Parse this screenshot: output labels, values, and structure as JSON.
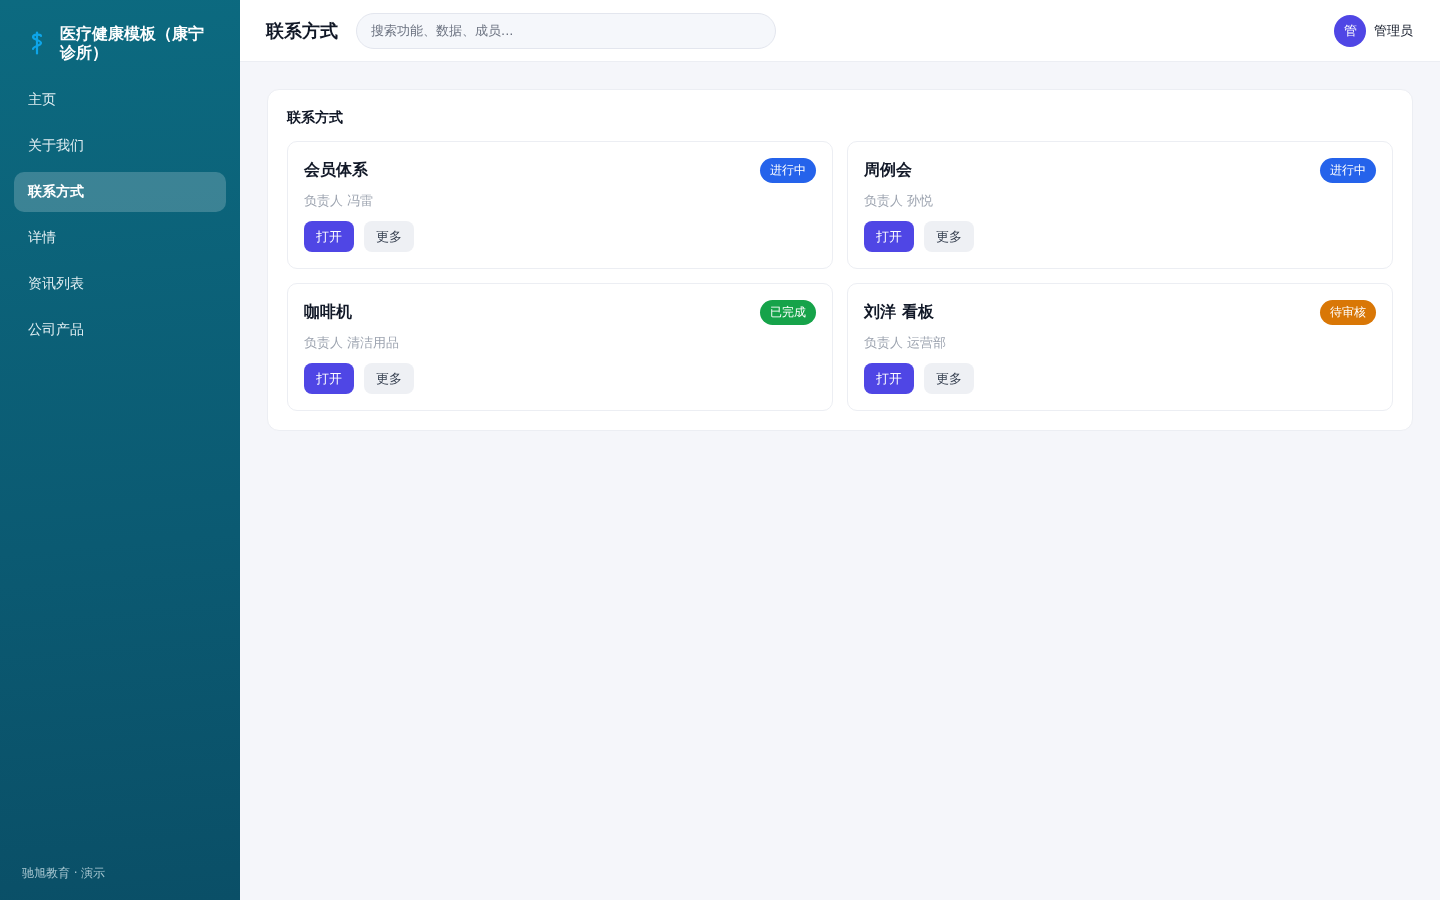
{
  "sidebar": {
    "brand": "医疗健康模板（康宁诊所）",
    "items": [
      {
        "label": "主页",
        "selected": false
      },
      {
        "label": "关于我们",
        "selected": false
      },
      {
        "label": "联系方式",
        "selected": true
      },
      {
        "label": "详情",
        "selected": false
      },
      {
        "label": "资讯列表",
        "selected": false
      },
      {
        "label": "公司产品",
        "selected": false
      }
    ],
    "footer": "驰旭教育 · 演示"
  },
  "topbar": {
    "title": "联系方式",
    "search": {
      "placeholder": "搜索功能、数据、成员..."
    },
    "user": {
      "avatar": "管",
      "name": "管理员"
    }
  },
  "panel": {
    "title": "联系方式",
    "cards": [
      {
        "title": "会员体系",
        "status": {
          "label": "进行中",
          "color": "#2563eb"
        },
        "owner": "负责人 冯雷",
        "buttons": [
          {
            "label": "打开",
            "kind": "primary"
          },
          {
            "label": "更多",
            "kind": "secondary"
          }
        ]
      },
      {
        "title": "周例会",
        "status": {
          "label": "进行中",
          "color": "#2563eb"
        },
        "owner": "负责人 孙悦",
        "buttons": [
          {
            "label": "打开",
            "kind": "primary"
          },
          {
            "label": "更多",
            "kind": "secondary"
          }
        ]
      },
      {
        "title": "咖啡机",
        "status": {
          "label": "已完成",
          "color": "#16a34a"
        },
        "owner": "负责人 清洁用品",
        "buttons": [
          {
            "label": "打开",
            "kind": "primary"
          },
          {
            "label": "更多",
            "kind": "secondary"
          }
        ]
      },
      {
        "title": "刘洋 看板",
        "status": {
          "label": "待审核",
          "color": "#d97706"
        },
        "owner": "负责人 运营部",
        "buttons": [
          {
            "label": "打开",
            "kind": "primary"
          },
          {
            "label": "更多",
            "kind": "secondary"
          }
        ]
      }
    ]
  }
}
